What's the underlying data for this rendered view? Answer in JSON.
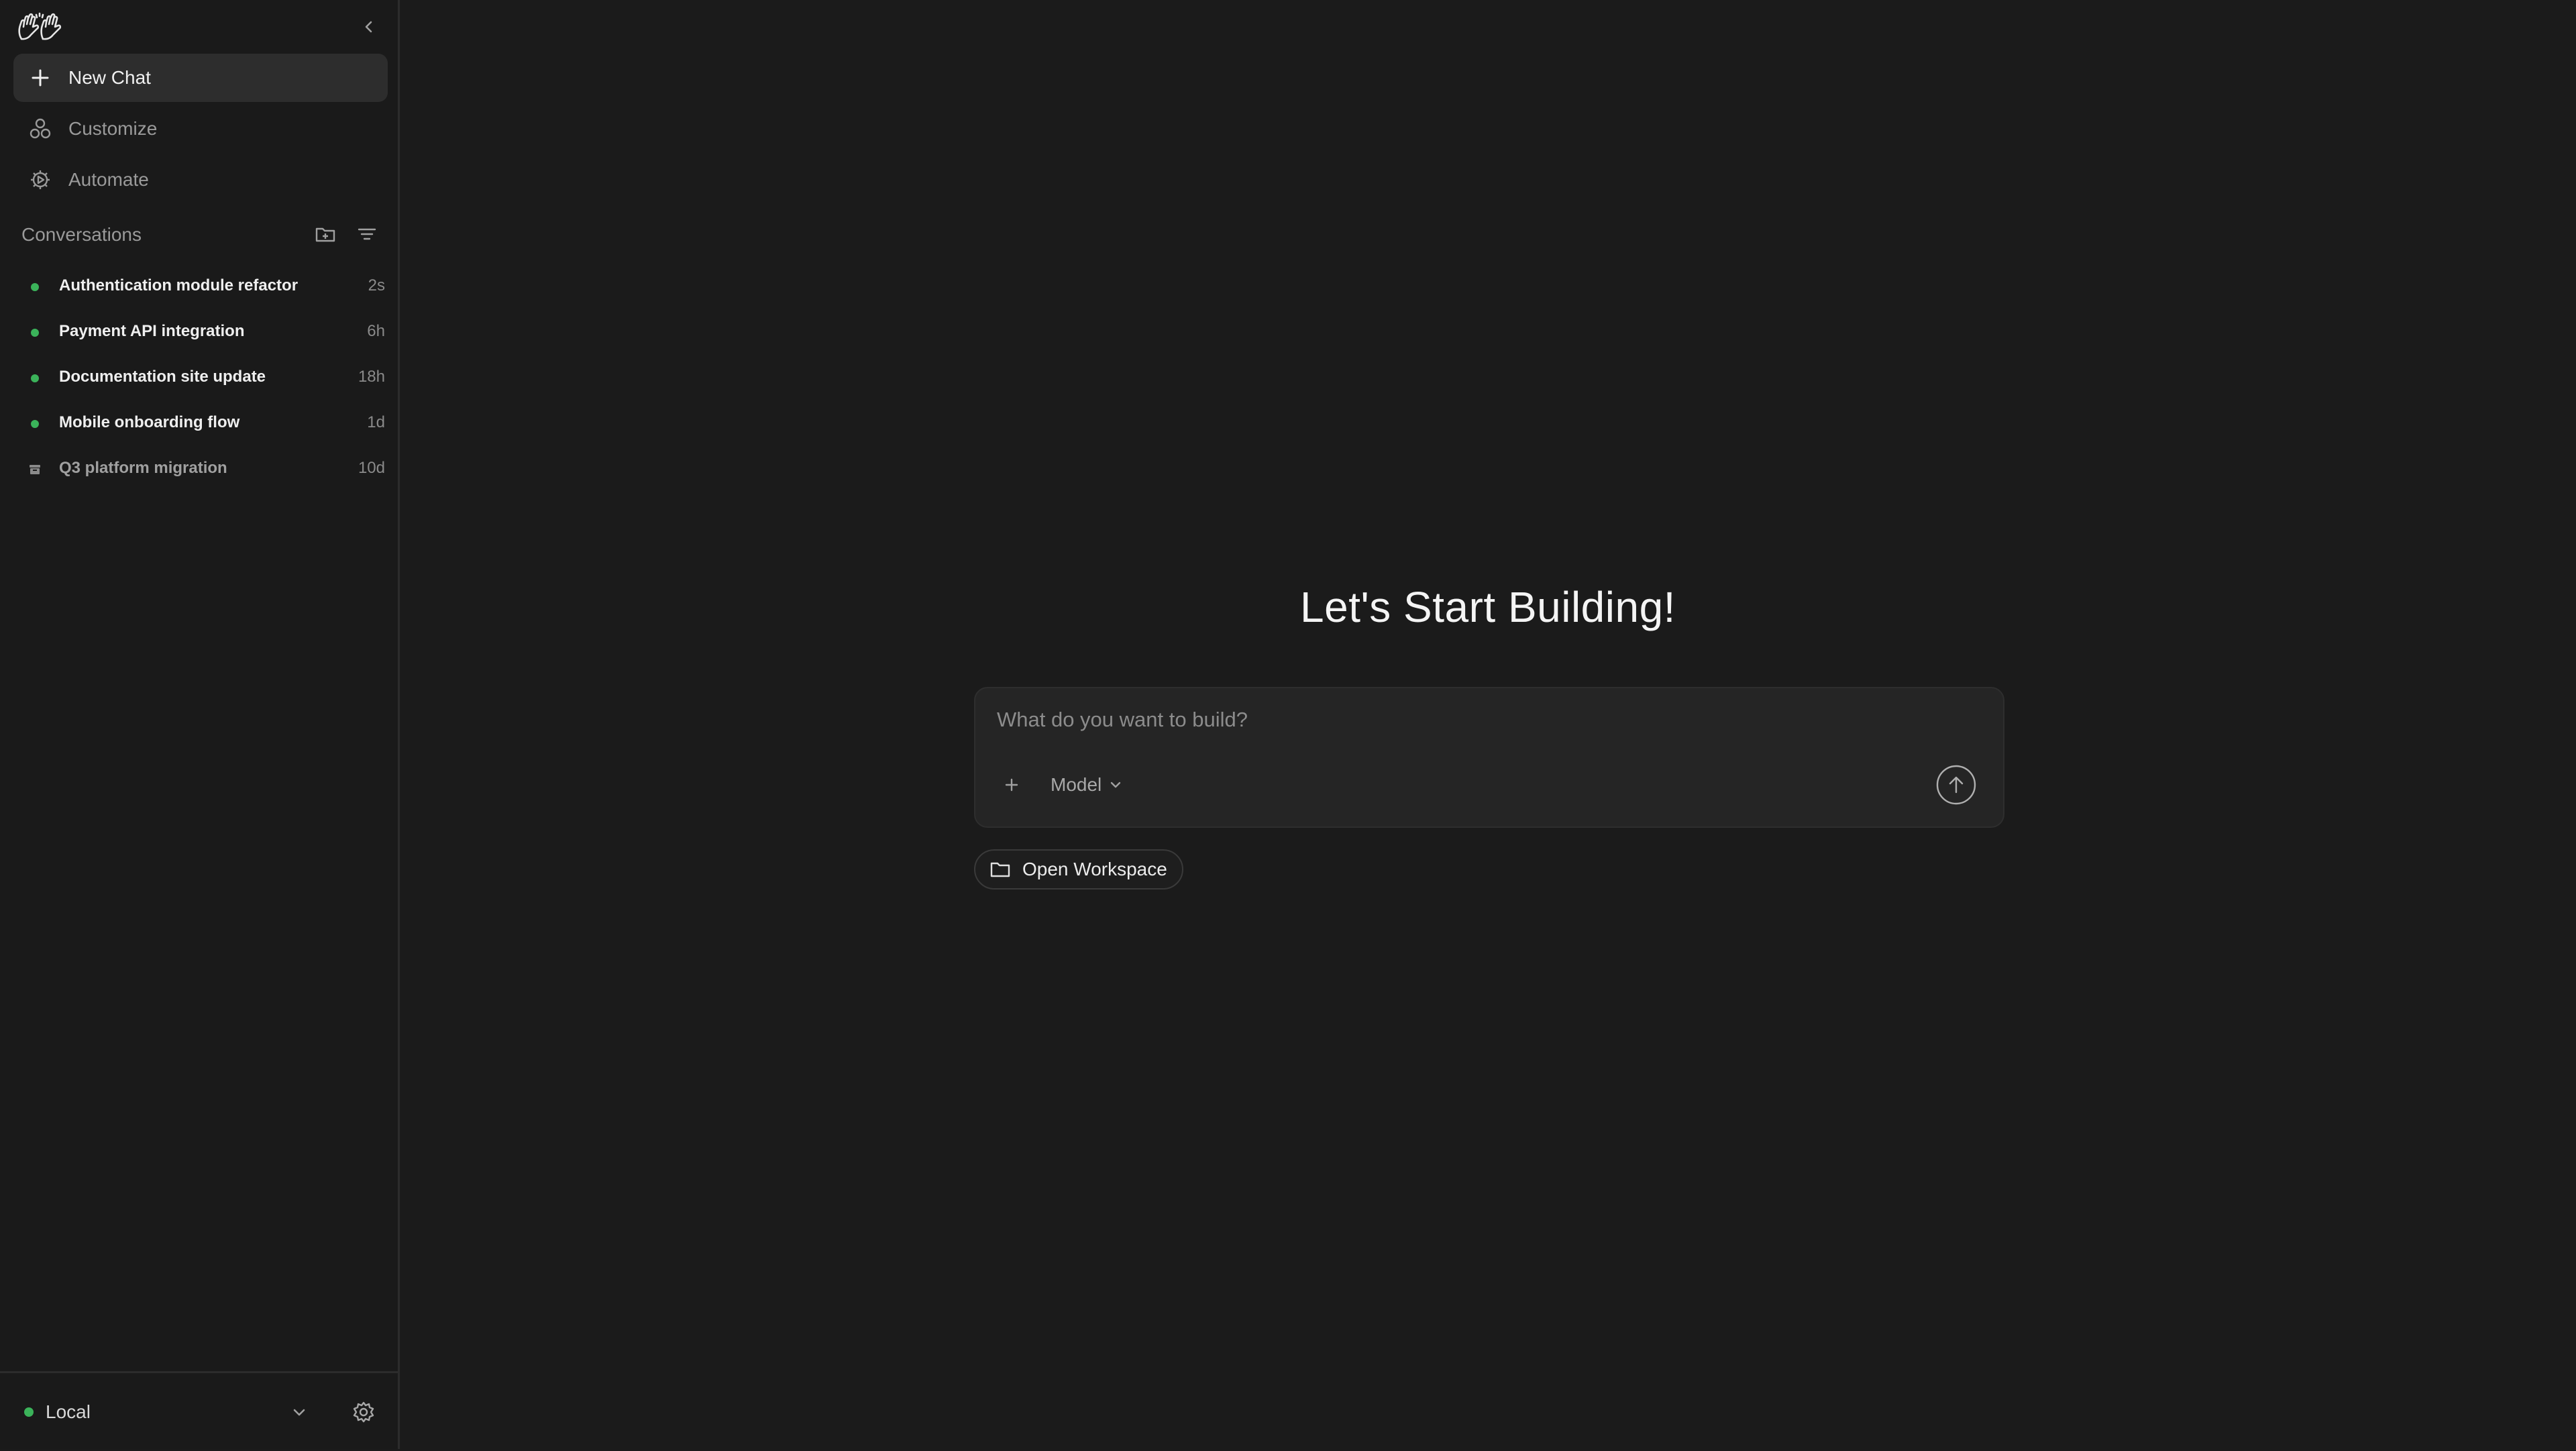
{
  "sidebar": {
    "logo_icon": "raised-hands-icon",
    "collapse_icon": "chevron-left-icon",
    "nav": [
      {
        "label": "New Chat",
        "icon": "plus-icon",
        "active": true
      },
      {
        "label": "Customize",
        "icon": "shapes-icon",
        "active": false
      },
      {
        "label": "Automate",
        "icon": "gear-play-icon",
        "active": false
      }
    ],
    "conversations": {
      "title": "Conversations",
      "new_folder_icon": "folder-plus-icon",
      "filter_icon": "filter-icon",
      "items": [
        {
          "name": "Authentication module refactor",
          "time": "2s",
          "status": "active"
        },
        {
          "name": "Payment API integration",
          "time": "6h",
          "status": "active"
        },
        {
          "name": "Documentation site update",
          "time": "18h",
          "status": "active"
        },
        {
          "name": "Mobile onboarding flow",
          "time": "1d",
          "status": "active"
        },
        {
          "name": "Q3 platform migration",
          "time": "10d",
          "status": "archived"
        }
      ]
    },
    "footer": {
      "environment": "Local",
      "status_color": "#3bb35a",
      "settings_icon": "gear-icon"
    }
  },
  "main": {
    "headline": "Let's Start Building!",
    "composer": {
      "placeholder": "What do you want to build?",
      "value": "",
      "model_label": "Model",
      "attach_icon": "plus-icon",
      "send_icon": "arrow-up-icon"
    },
    "workspace_button": {
      "label": "Open Workspace",
      "icon": "folder-icon"
    }
  },
  "colors": {
    "background": "#1b1b1b",
    "sidebar": "#1a1a1a",
    "accent_green": "#3bb35a",
    "active_item": "#2d2d2d"
  }
}
